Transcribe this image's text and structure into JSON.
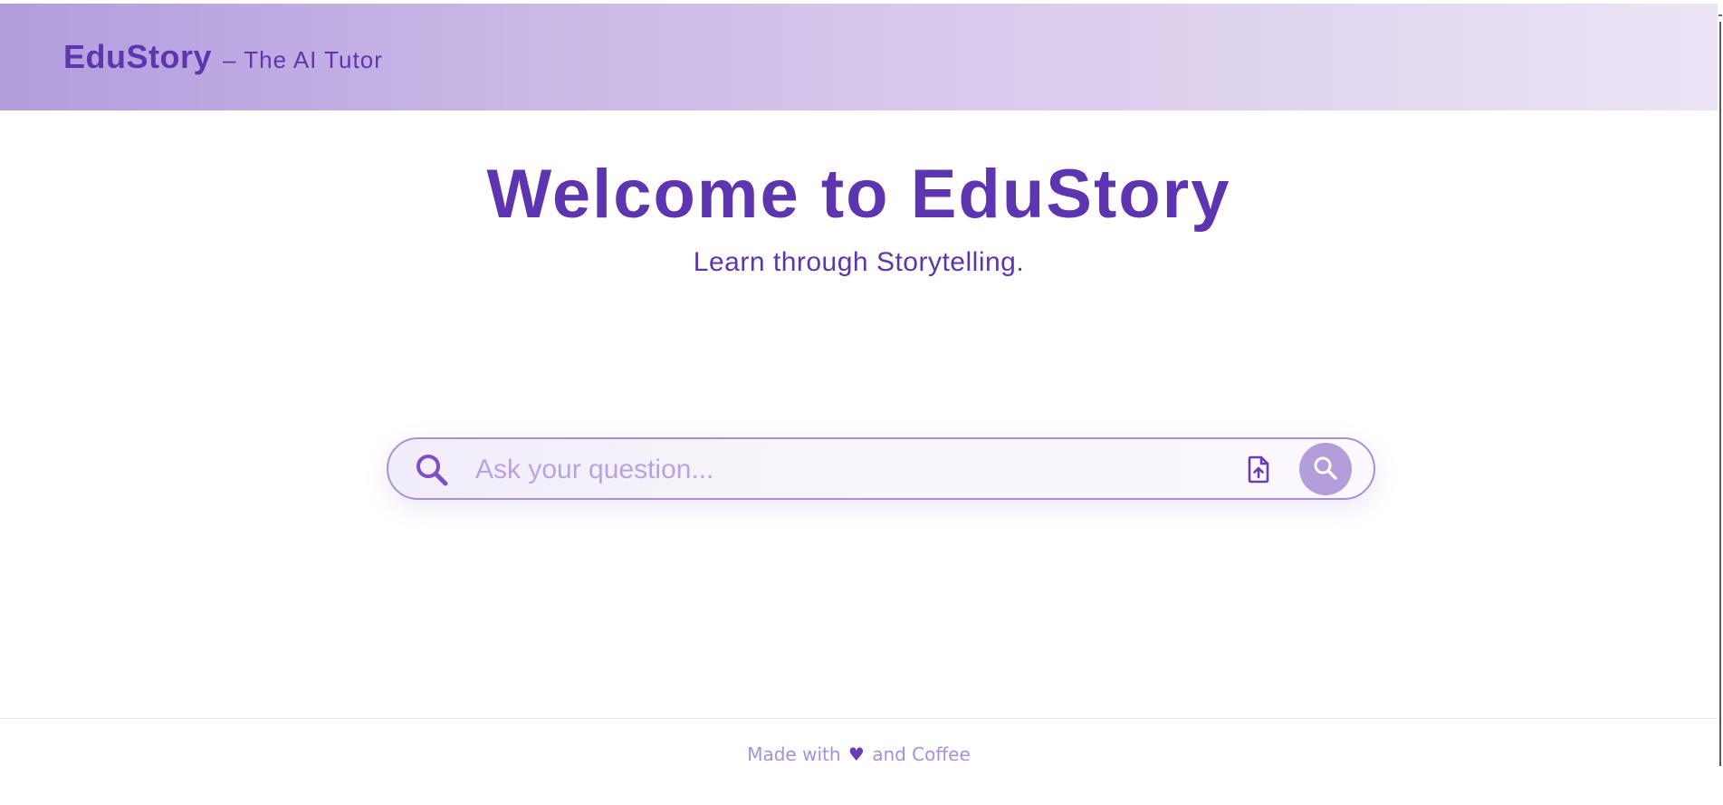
{
  "header": {
    "brand": "EduStory",
    "tagline": "– The AI Tutor"
  },
  "hero": {
    "title": "Welcome to EduStory",
    "subtitle": "Learn through Storytelling."
  },
  "search": {
    "placeholder": "Ask your question...",
    "value": "",
    "icons": {
      "leading": "search-icon",
      "upload": "file-upload-icon",
      "submit": "search-icon"
    }
  },
  "footer": {
    "prefix": "Made with",
    "heart": "♥",
    "suffix": "and Coffee"
  },
  "colors": {
    "primary": "#5e35b1",
    "accent": "#b39ddb",
    "border": "#a98fd9",
    "header_start": "#b19ddd",
    "header_end": "#ece4f6"
  }
}
